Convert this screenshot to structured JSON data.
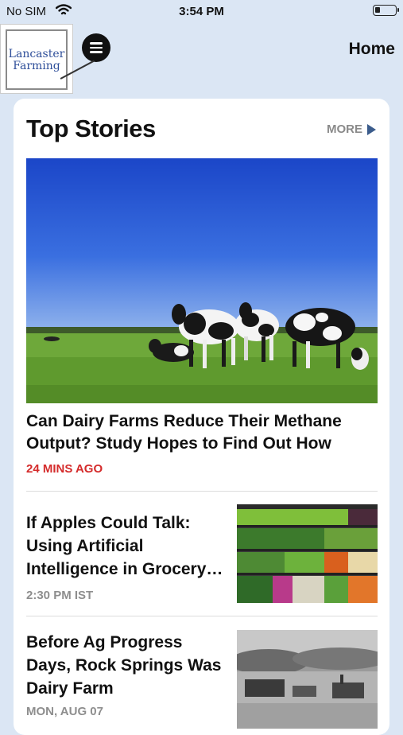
{
  "status_bar": {
    "carrier": "No SIM",
    "time": "3:54 PM"
  },
  "header": {
    "logo_line1": "Lancaster",
    "logo_line2": "Farming",
    "title": "Home"
  },
  "section": {
    "title": "Top Stories",
    "more_label": "MORE"
  },
  "featured": {
    "headline": "Can Dairy Farms Reduce Their Methane Output? Study Hopes to Find Out How",
    "time": "24 MINS AGO"
  },
  "stories": [
    {
      "title": "If Apples Could Talk: Using Artificial Intelligence in Grocery…",
      "time": "2:30 PM IST"
    },
    {
      "title": "Before Ag Progress Days, Rock Springs Was Dairy Farm",
      "time": "MON, AUG 07"
    }
  ],
  "colors": {
    "background": "#dbe6f4",
    "accent_red": "#d42b2b",
    "more_arrow": "#3b5c8c"
  }
}
